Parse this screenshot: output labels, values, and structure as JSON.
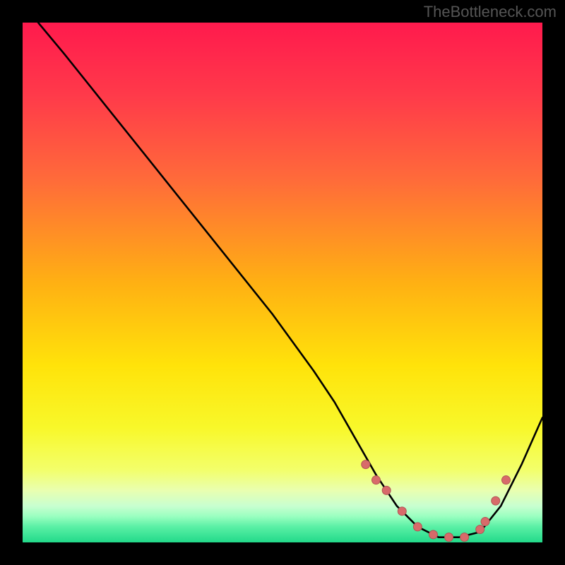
{
  "watermark": "TheBottleneck.com",
  "colors": {
    "background": "#000000",
    "curve": "#000000",
    "marker_fill": "#d86a6a",
    "marker_stroke": "#b05555",
    "gradient_stops": [
      {
        "offset": 0,
        "color": "#ff1a4d"
      },
      {
        "offset": 0.14,
        "color": "#ff3a4a"
      },
      {
        "offset": 0.3,
        "color": "#ff6a3a"
      },
      {
        "offset": 0.5,
        "color": "#ffb013"
      },
      {
        "offset": 0.66,
        "color": "#ffe30a"
      },
      {
        "offset": 0.78,
        "color": "#f8f82a"
      },
      {
        "offset": 0.86,
        "color": "#f3ff6a"
      },
      {
        "offset": 0.9,
        "color": "#e9ffb0"
      },
      {
        "offset": 0.93,
        "color": "#c8ffd0"
      },
      {
        "offset": 0.95,
        "color": "#9affc0"
      },
      {
        "offset": 0.97,
        "color": "#5af0a5"
      },
      {
        "offset": 1.0,
        "color": "#22d98a"
      }
    ]
  },
  "chart_data": {
    "type": "line",
    "title": "",
    "xlabel": "",
    "ylabel": "",
    "xlim": [
      0,
      100
    ],
    "ylim": [
      0,
      100
    ],
    "series": [
      {
        "name": "bottleneck-curve",
        "x": [
          3,
          8,
          16,
          24,
          32,
          40,
          48,
          56,
          60,
          64,
          68,
          72,
          76,
          80,
          84,
          88,
          92,
          96,
          100
        ],
        "y": [
          100,
          94,
          84,
          74,
          64,
          54,
          44,
          33,
          27,
          20,
          13,
          7,
          3,
          1,
          1,
          2,
          7,
          15,
          24
        ]
      }
    ],
    "markers": {
      "name": "highlight-points",
      "x": [
        66,
        68,
        70,
        73,
        76,
        79,
        82,
        85,
        88,
        89,
        91,
        93
      ],
      "y": [
        15,
        12,
        10,
        6,
        3,
        1.5,
        1,
        1,
        2.5,
        4,
        8,
        12
      ]
    }
  }
}
